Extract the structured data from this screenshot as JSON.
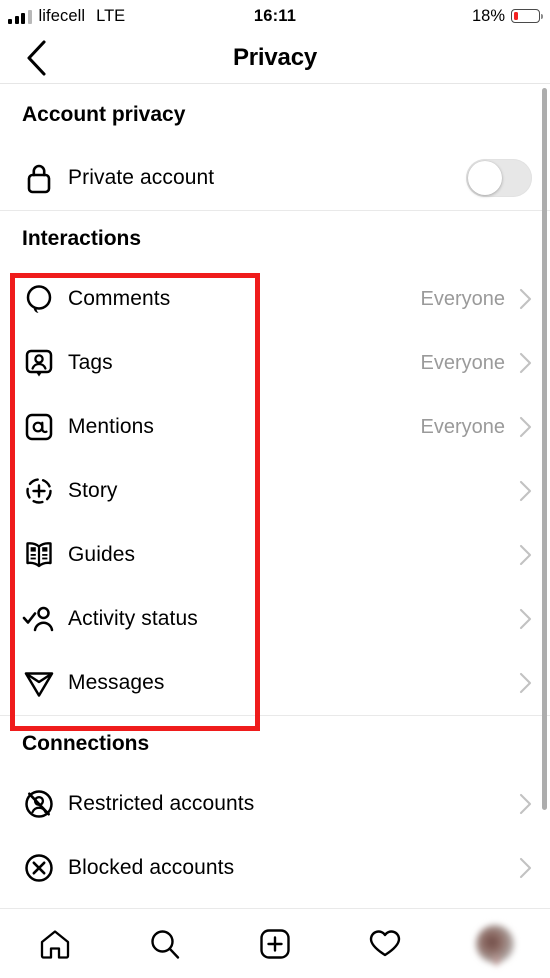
{
  "status_bar": {
    "carrier": "lifecell",
    "network": "LTE",
    "time": "16:11",
    "battery_percent": "18%",
    "battery_level": 18,
    "battery_color": "#f42222",
    "signal_icon": "signal-bars-icon"
  },
  "header": {
    "title": "Privacy",
    "back_icon": "chevron-left-icon"
  },
  "sections": [
    {
      "title": "Account privacy",
      "rows": [
        {
          "icon": "lock-icon",
          "label": "Private account",
          "control": "toggle",
          "toggle_on": false
        }
      ]
    },
    {
      "title": "Interactions",
      "rows": [
        {
          "icon": "comment-icon",
          "label": "Comments",
          "value": "Everyone",
          "chevron": true
        },
        {
          "icon": "tag-person-icon",
          "label": "Tags",
          "value": "Everyone",
          "chevron": true
        },
        {
          "icon": "mention-at-icon",
          "label": "Mentions",
          "value": "Everyone",
          "chevron": true
        },
        {
          "icon": "story-plus-icon",
          "label": "Story",
          "value": "",
          "chevron": true
        },
        {
          "icon": "guides-book-icon",
          "label": "Guides",
          "value": "",
          "chevron": true
        },
        {
          "icon": "activity-status-icon",
          "label": "Activity status",
          "value": "",
          "chevron": true
        },
        {
          "icon": "messages-paperplane-icon",
          "label": "Messages",
          "value": "",
          "chevron": true
        }
      ]
    },
    {
      "title": "Connections",
      "rows": [
        {
          "icon": "restricted-account-icon",
          "label": "Restricted accounts",
          "value": "",
          "chevron": true
        },
        {
          "icon": "blocked-account-icon",
          "label": "Blocked accounts",
          "value": "",
          "chevron": true
        }
      ]
    }
  ],
  "annotation": {
    "type": "highlight-rectangle",
    "color": "#ef1c1c",
    "covers": "Interactions list rows"
  },
  "tab_bar": {
    "tabs": [
      {
        "icon": "home-icon",
        "label": "Home"
      },
      {
        "icon": "search-icon",
        "label": "Search"
      },
      {
        "icon": "create-plus-icon",
        "label": "Create"
      },
      {
        "icon": "heart-icon",
        "label": "Activity"
      },
      {
        "icon": "profile-avatar-icon",
        "label": "Profile"
      }
    ]
  }
}
